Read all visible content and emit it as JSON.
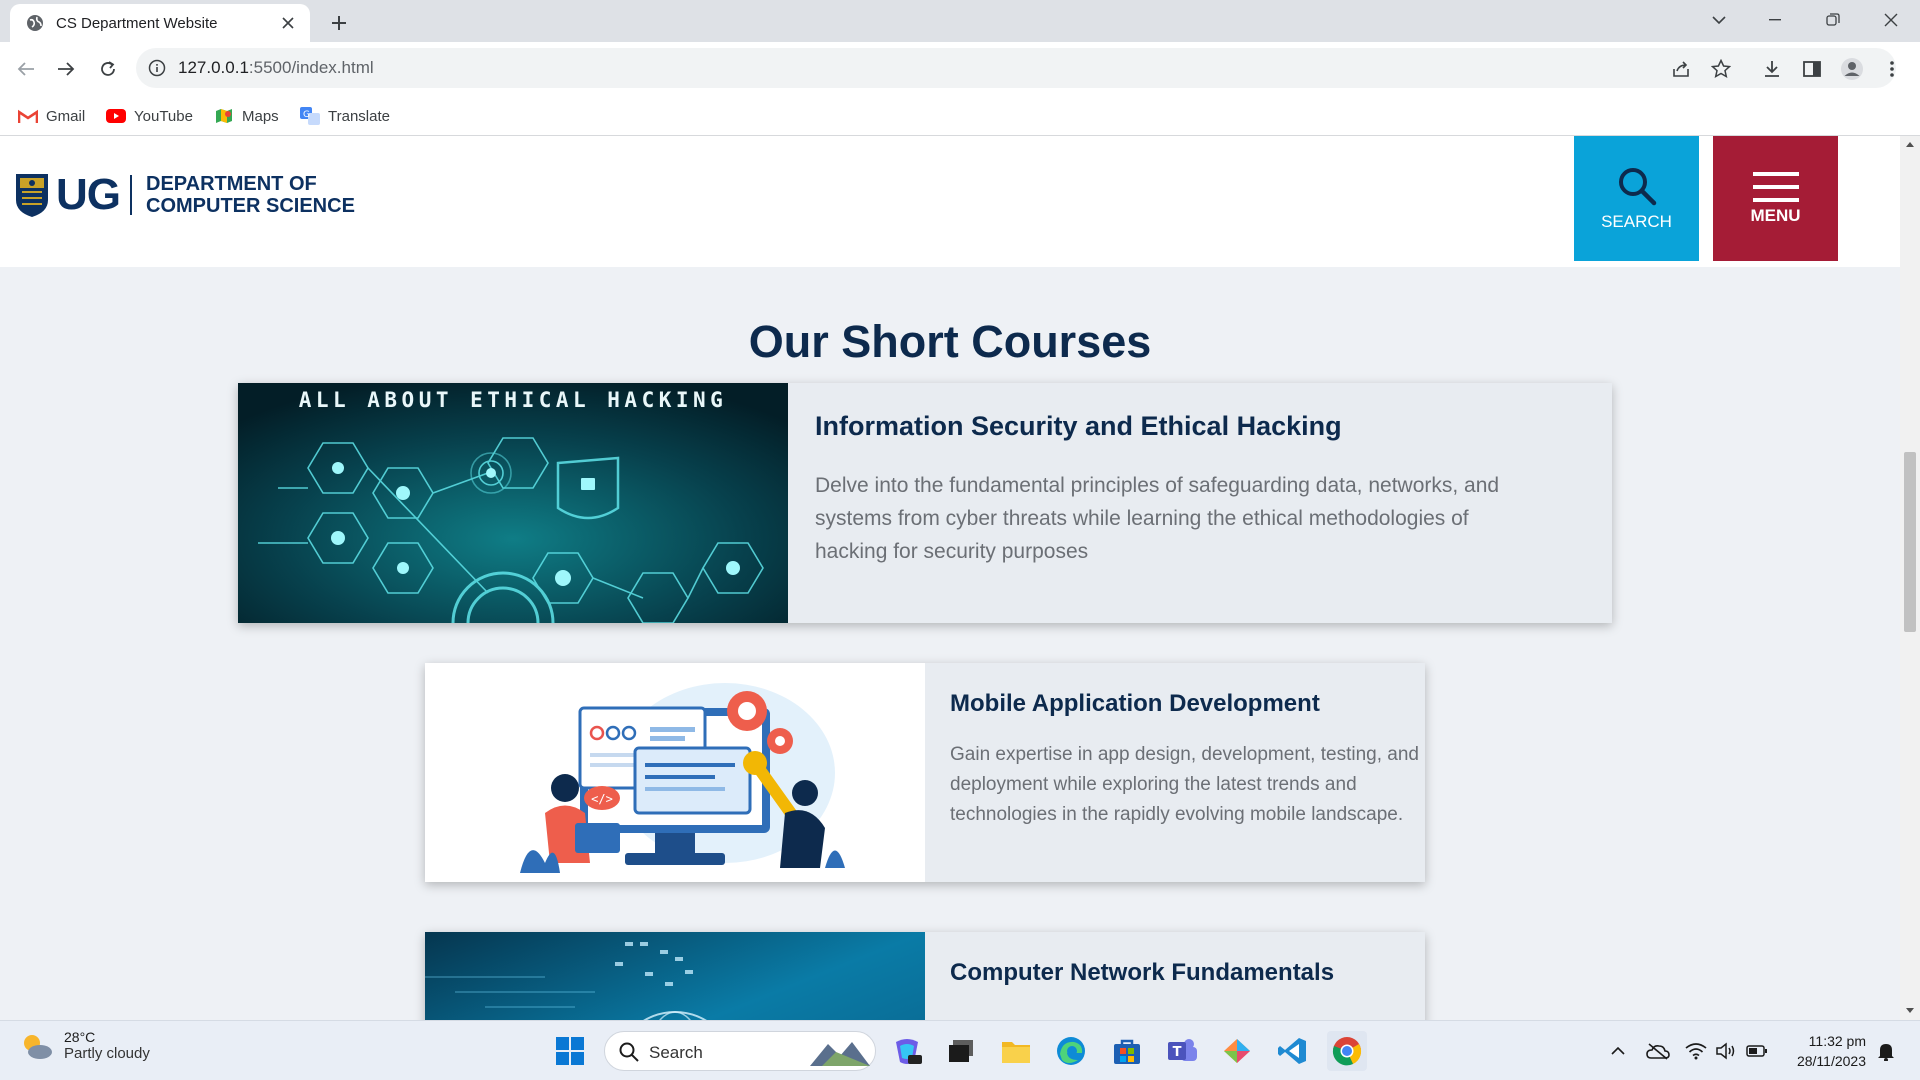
{
  "browser": {
    "tab_title": "CS Department Website",
    "url_host": "127.0.0.1",
    "url_rest": ":5500/index.html",
    "bookmarks": [
      {
        "label": "Gmail"
      },
      {
        "label": "YouTube"
      },
      {
        "label": "Maps"
      },
      {
        "label": "Translate"
      }
    ]
  },
  "site": {
    "logo_ug": "UG",
    "dept_line1": "DEPARTMENT OF",
    "dept_line2": "COMPUTER SCIENCE",
    "search_label": "SEARCH",
    "menu_label": "MENU",
    "colors": {
      "navy": "#0d2a4d",
      "search": "#0aa3d9",
      "menu": "#a51c36"
    }
  },
  "section": {
    "title": "Our Short Courses",
    "courses": [
      {
        "image_caption": "ALL ABOUT ETHICAL HACKING",
        "title": "Information Security and Ethical Hacking",
        "description": "Delve into the fundamental principles of safeguarding data, networks, and systems from cyber threats while learning the ethical methodologies of hacking for security purposes"
      },
      {
        "title": "Mobile Application Development",
        "description": "Gain expertise in app design, development, testing, and deployment while exploring the latest trends and technologies in the rapidly evolving mobile landscape."
      },
      {
        "title": "Computer Network Fundamentals",
        "description": ""
      }
    ]
  },
  "taskbar": {
    "weather_temp": "28°C",
    "weather_cond": "Partly cloudy",
    "search_label": "Search",
    "time": "11:32 pm",
    "date": "28/11/2023"
  }
}
